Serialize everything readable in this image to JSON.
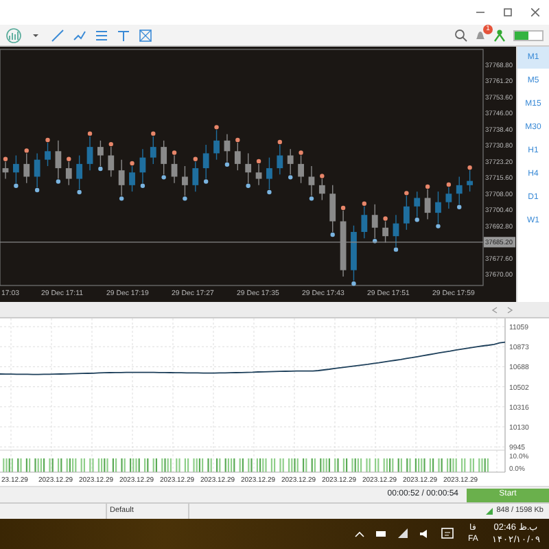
{
  "toolbar": {
    "notification_count": "1",
    "algo_trading_on": true
  },
  "chart": {
    "time_labels": [
      "17:03",
      "29 Dec 17:11",
      "29 Dec 17:19",
      "29 Dec 17:27",
      "29 Dec 17:35",
      "29 Dec 17:43",
      "29 Dec 17:51",
      "29 Dec 17:59"
    ],
    "chart_data": {
      "type": "candlestick",
      "ylim": [
        37664.8,
        37775.9
      ],
      "ref_lines": [
        {
          "axis": "y",
          "value": 37685.2,
          "label": "37685.20"
        }
      ],
      "yticks": [
        {
          "value": 37768.8,
          "label": "37768.80"
        },
        {
          "value": 37761.2,
          "label": "37761.20"
        },
        {
          "value": 37753.6,
          "label": "37753.60"
        },
        {
          "value": 37746,
          "label": "37746.00"
        },
        {
          "value": 37738.4,
          "label": "37738.40"
        },
        {
          "value": 37730.8,
          "label": "37730.80"
        },
        {
          "value": 37723.2,
          "label": "37723.20"
        },
        {
          "value": 37715.6,
          "label": "37715.60"
        },
        {
          "value": 37708,
          "label": "37708.00"
        },
        {
          "value": 37700.4,
          "label": "37700.40"
        },
        {
          "value": 37692.8,
          "label": "37692.80"
        },
        {
          "value": 37677.6,
          "label": "37677.60"
        },
        {
          "value": 37670,
          "label": "37670.00"
        }
      ],
      "categories": [
        null,
        null,
        null,
        null,
        null,
        null,
        null,
        null,
        null,
        null,
        null,
        null,
        null,
        null,
        null,
        null,
        null,
        null,
        null,
        null,
        null,
        null,
        null,
        null,
        null,
        null,
        null,
        null,
        null,
        null,
        null,
        null,
        null,
        null,
        null,
        null,
        null,
        null,
        null,
        null,
        null,
        null,
        null,
        null,
        null
      ],
      "ohlc": [
        [
          37720,
          37723,
          37715,
          37718
        ],
        [
          37718,
          37726,
          37713,
          37722
        ],
        [
          37722,
          37727,
          37713,
          37716
        ],
        [
          37716,
          37727,
          37711,
          37724
        ],
        [
          37724,
          37732,
          37721,
          37728
        ],
        [
          37728,
          37733,
          37715,
          37720
        ],
        [
          37720,
          37723,
          37712,
          37715
        ],
        [
          37715,
          37726,
          37710,
          37722
        ],
        [
          37722,
          37735,
          37719,
          37730
        ],
        [
          37730,
          37733,
          37721,
          37726
        ],
        [
          37726,
          37730,
          37716,
          37719
        ],
        [
          37719,
          37724,
          37707,
          37712
        ],
        [
          37712,
          37721,
          37709,
          37718
        ],
        [
          37718,
          37729,
          37713,
          37725
        ],
        [
          37725,
          37735,
          37722,
          37730
        ],
        [
          37730,
          37733,
          37717,
          37722
        ],
        [
          37722,
          37726,
          37713,
          37716
        ],
        [
          37716,
          37721,
          37707,
          37712
        ],
        [
          37712,
          37723,
          37709,
          37720
        ],
        [
          37720,
          37731,
          37715,
          37727
        ],
        [
          37727,
          37738,
          37724,
          37733
        ],
        [
          37733,
          37736,
          37723,
          37728
        ],
        [
          37728,
          37732,
          37719,
          37722
        ],
        [
          37722,
          37727,
          37713,
          37718
        ],
        [
          37718,
          37722,
          37712,
          37715
        ],
        [
          37715,
          37725,
          37710,
          37720
        ],
        [
          37720,
          37731,
          37717,
          37726
        ],
        [
          37726,
          37729,
          37717,
          37722
        ],
        [
          37722,
          37726,
          37713,
          37716
        ],
        [
          37716,
          37721,
          37707,
          37712
        ],
        [
          37712,
          37715,
          37705,
          37708
        ],
        [
          37708,
          37712,
          37690,
          37695
        ],
        [
          37695,
          37700,
          37669,
          37672
        ],
        [
          37672,
          37693,
          37667,
          37690
        ],
        [
          37690,
          37702,
          37687,
          37698
        ],
        [
          37698,
          37703,
          37687,
          37692
        ],
        [
          37692,
          37695,
          37685,
          37688
        ],
        [
          37688,
          37698,
          37683,
          37694
        ],
        [
          37694,
          37707,
          37691,
          37702
        ],
        [
          37702,
          37709,
          37697,
          37706
        ],
        [
          37706,
          37710,
          37696,
          37699
        ],
        [
          37699,
          37709,
          37694,
          37704
        ],
        [
          37704,
          37711,
          37701,
          37708
        ],
        [
          37708,
          37716,
          37703,
          37712
        ],
        [
          37712,
          37719,
          37709,
          37714
        ]
      ]
    }
  },
  "timeframes": [
    {
      "label": "M1",
      "selected": true
    },
    {
      "label": "M5",
      "selected": false
    },
    {
      "label": "M15",
      "selected": false
    },
    {
      "label": "M30",
      "selected": false
    },
    {
      "label": "H1",
      "selected": false
    },
    {
      "label": "H4",
      "selected": false
    },
    {
      "label": "D1",
      "selected": false
    },
    {
      "label": "W1",
      "selected": false
    }
  ],
  "equity_chart": {
    "value_ticks": [
      "11059",
      "10873",
      "10688",
      "10502",
      "10316",
      "10130",
      "9945"
    ],
    "percent_ticks": [
      "10.0%",
      "0.0%"
    ],
    "date_labels": [
      "23.12.29",
      "2023.12.29",
      "2023.12.29",
      "2023.12.29",
      "2023.12.29",
      "2023.12.29",
      "2023.12.29",
      "2023.12.29",
      "2023.12.29",
      "2023.12.29",
      "2023.12.29",
      "2023.12.29"
    ]
  },
  "tester": {
    "elapsed": "00:00:52 / 00:00:54",
    "start_button": "Start"
  },
  "status_bar": {
    "profile": "Default",
    "traffic": "848 / 1598 Kb"
  },
  "taskbar": {
    "language": "فا",
    "language_code": "FA",
    "time": "ب.ظ 02:46",
    "date": "۱۴۰۲/۱۰/۰۹"
  }
}
